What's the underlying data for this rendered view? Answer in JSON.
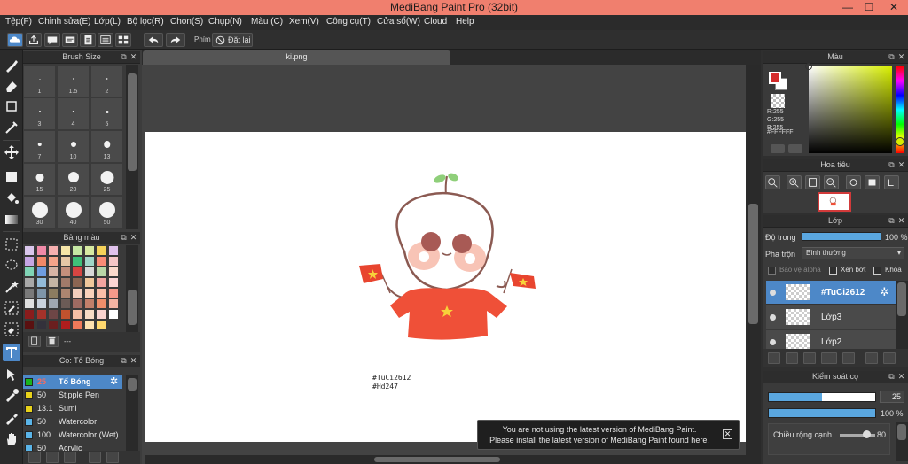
{
  "window": {
    "title": "MediBang Paint Pro (32bit)"
  },
  "menu": [
    "Tệp(F)",
    "Chỉnh sửa(E)",
    "Lớp(L)",
    "Bộ lọc(R)",
    "Chọn(S)",
    "Chụp(N)",
    "Màu (C)",
    "Xem(V)",
    "Công cụ(T)",
    "Cửa sổ(W)",
    "Cloud",
    "Help"
  ],
  "toolbar": {
    "shortcut_label": "Phím",
    "reset_label": "Đặt lại"
  },
  "brush_size_panel": {
    "title": "Brush Size",
    "sizes": [
      "1",
      "1.5",
      "2",
      "3",
      "4",
      "5",
      "7",
      "10",
      "13",
      "15",
      "20",
      "25",
      "30",
      "40",
      "50"
    ]
  },
  "palette_panel": {
    "title": "Bảng màu",
    "footer_text": "---",
    "colors": [
      "#d9c6ec",
      "#f08aa8",
      "#f7b0b0",
      "#f5e5a8",
      "#c6e8a4",
      "#d6eaa2",
      "#f5d25a",
      "#e0c2ec",
      "#c5a4e4",
      "#f28868",
      "#f6a48a",
      "#e6c7a6",
      "#3ec079",
      "#9fd6c8",
      "#fa8b77",
      "#f5c6c6",
      "#7fd3b5",
      "#6f9de0",
      "#d6b3a4",
      "#c48f7c",
      "#d64542",
      "#d8d8d8",
      "#b9d6a7",
      "#fbd9cb",
      "#a8a8a8",
      "#93bbd8",
      "#c3b4a4",
      "#a17a6a",
      "#8b6552",
      "#f0c79b",
      "#f3a5a0",
      "#fcd5d3",
      "#7a7a7a",
      "#7f95a8",
      "#8c7c60",
      "#ad8570",
      "#f3cfbd",
      "#fad2bb",
      "#fbbfa9",
      "#f59a8b",
      "#e0e0e0",
      "#c9d2dc",
      "#a0a8b1",
      "#6b5b56",
      "#9e6b62",
      "#c17f6a",
      "#f08e6b",
      "#f4b4a3",
      "#8a1c1c",
      "#a4322a",
      "#6e4646",
      "#c1522e",
      "#f5c0a6",
      "#f8dcc5",
      "#fad4cf",
      "#ffffff",
      "#5a1010",
      "#33313b",
      "#6a1f1f",
      "#b11d1d",
      "#f07a5a",
      "#fde1b0",
      "#ffd86e",
      "#3a3a3a"
    ]
  },
  "brush_list_panel": {
    "title": "Cọ: Tổ Bóng",
    "brushes": [
      {
        "size": "25",
        "name": "Tổ Bóng",
        "color": "#19b41e",
        "selected": true
      },
      {
        "size": "50",
        "name": "Stipple Pen",
        "color": "#e8d21a",
        "selected": false
      },
      {
        "size": "13.1",
        "name": "Sumi",
        "color": "#e8d21a",
        "selected": false
      },
      {
        "size": "50",
        "name": "Watercolor",
        "color": "#5ab4e8",
        "selected": false
      },
      {
        "size": "100",
        "name": "Watercolor (Wet)",
        "color": "#5ab4e8",
        "selected": false
      },
      {
        "size": "50",
        "name": "Acrylic",
        "color": "#5ab4e8",
        "selected": false
      }
    ]
  },
  "canvas": {
    "tab_name": "ki.png",
    "signature_line1": "#TuCi2612",
    "signature_line2": "#Hd247"
  },
  "notification": {
    "line1": "You are not using the latest version of MediBang Paint.",
    "line2": "Please install the latest version of MediBang Paint found here."
  },
  "color_panel": {
    "title": "Màu",
    "r_label": "R:255",
    "g_label": "G:255",
    "b_label": "B:255",
    "hex": "#FFFFFF",
    "primary": "#d42b2b",
    "secondary": "#ffffff"
  },
  "navigator_panel": {
    "title": "Hoa tiêu"
  },
  "layer_panel": {
    "title": "Lớp",
    "opacity_label": "Độ trong",
    "opacity_value": "100 %",
    "opacity": 100,
    "blend_label": "Pha trộn",
    "blend_value": "Bình thường",
    "protect_alpha": "Bảo vệ alpha",
    "clipping": "Xén bớt",
    "lock": "Khóa",
    "layers": [
      {
        "name": "#TuCi2612",
        "selected": true
      },
      {
        "name": "Lớp3",
        "selected": false
      },
      {
        "name": "Lớp2",
        "selected": false
      }
    ]
  },
  "brush_control_panel": {
    "title": "Kiểm soát cọ",
    "size_value": "25",
    "size_fraction": 0.5,
    "opacity_value": "100 %",
    "opacity": 100,
    "edge_label": "Chiều rộng cạnh",
    "edge_value": "80"
  }
}
